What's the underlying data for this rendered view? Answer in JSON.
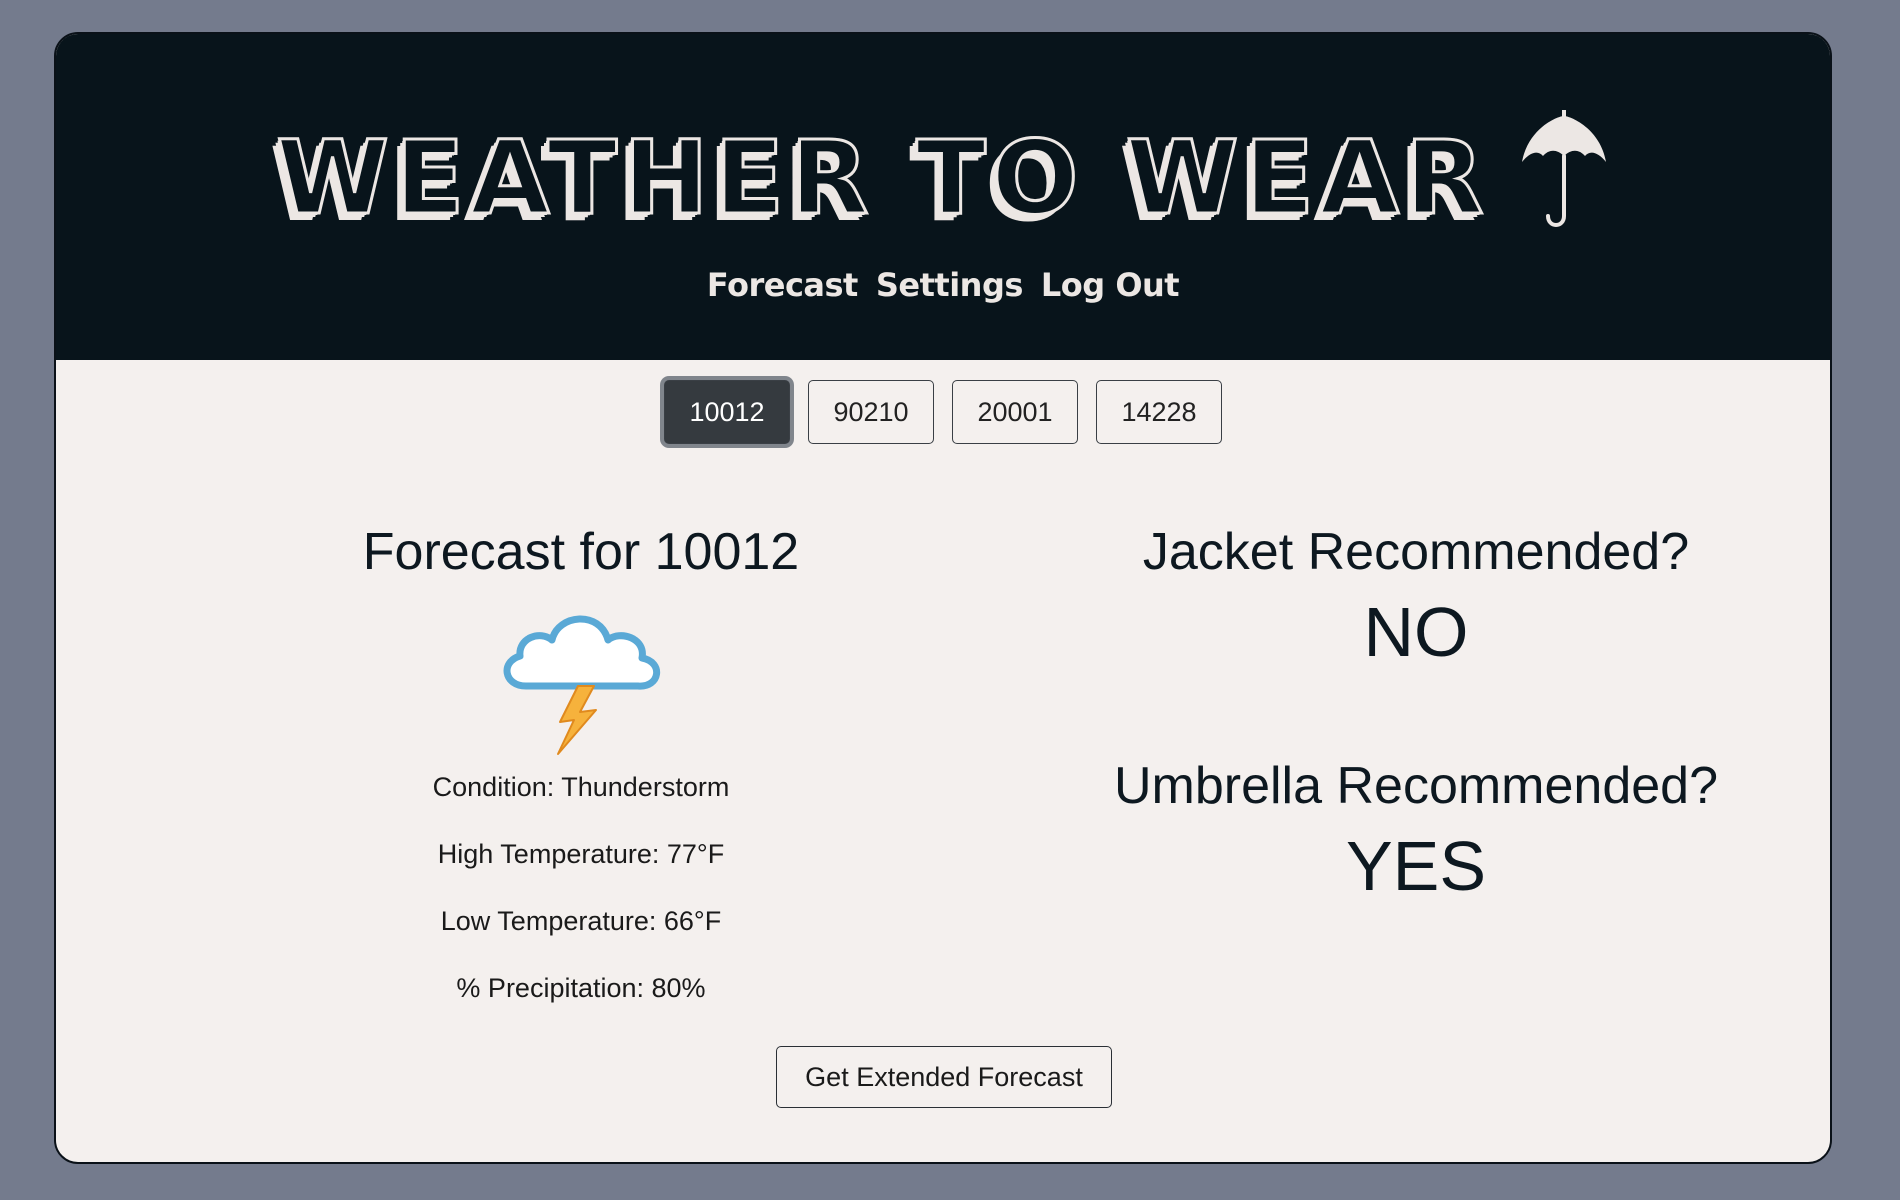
{
  "header": {
    "title": "WEATHER TO WEAR",
    "logo_icon": "umbrella-icon",
    "nav": [
      "Forecast",
      "Settings",
      "Log Out"
    ]
  },
  "zip_tabs": {
    "items": [
      "10012",
      "90210",
      "20001",
      "14228"
    ],
    "selected": "10012"
  },
  "forecast": {
    "title": "Forecast for 10012",
    "icon": "thunderstorm-icon",
    "condition": "Condition: Thunderstorm",
    "high": "High Temperature: 77°F",
    "low": "Low Temperature: 66°F",
    "precipitation": "% Precipitation: 80%"
  },
  "recommendations": {
    "jacket_question": "Jacket Recommended?",
    "jacket_answer": "NO",
    "umbrella_question": "Umbrella Recommended?",
    "umbrella_answer": "YES"
  },
  "extended_button": "Get Extended Forecast",
  "colors": {
    "page_bg": "#747b8d",
    "header_bg": "#08141b",
    "card_bg": "#f4f0ee",
    "title_text": "#ece7e4",
    "active_tab": "#353a3f"
  }
}
